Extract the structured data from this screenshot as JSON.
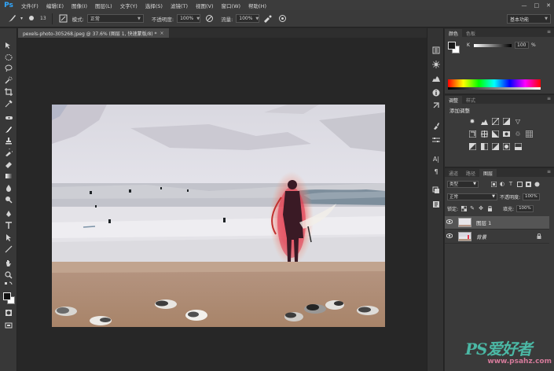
{
  "app": {
    "logo": "Ps"
  },
  "menubar": {
    "items": [
      "文件(F)",
      "编辑(E)",
      "图像(I)",
      "图层(L)",
      "文字(Y)",
      "选择(S)",
      "滤镜(T)",
      "视图(V)",
      "窗口(W)",
      "帮助(H)"
    ],
    "window_controls": [
      "—",
      "□",
      "✕"
    ]
  },
  "optionsbar": {
    "brush_size": "13",
    "mode_label": "模式:",
    "mode_value": "正常",
    "opacity_label": "不透明度:",
    "opacity_value": "100%",
    "flow_label": "流量:",
    "flow_value": "100%",
    "workspace": "基本功能"
  },
  "document": {
    "tab_title": "pexels-photo-305268.jpeg @ 37.6% (图层 1, 快速蒙版/8) *",
    "close_glyph": "×"
  },
  "panels": {
    "color_tabs": [
      "颜色",
      "色板"
    ],
    "k_label": "K",
    "k_value": "100",
    "k_unit": "%",
    "adjust_tabs": [
      "调整",
      "样式"
    ],
    "adjust_title": "添加调整",
    "layer_tabs": [
      "通道",
      "路径",
      "图层"
    ],
    "filter_kind": "类型",
    "blend_mode": "正常",
    "opacity_label": "不透明度:",
    "opacity_value": "100%",
    "lock_label": "锁定:",
    "fill_label": "填充:",
    "fill_value": "100%",
    "layers": [
      {
        "name": "图层 1",
        "selected": true,
        "locked": false
      },
      {
        "name": "背景",
        "selected": false,
        "locked": true
      }
    ]
  },
  "watermark": {
    "main": "PS爱好者",
    "sub": "www.psahz.com"
  },
  "colors": {
    "accent": "#31a8ff",
    "quickmask_red": "#e8384f",
    "watermark_green": "#4bb8a5",
    "watermark_pink": "#d47a9a"
  }
}
